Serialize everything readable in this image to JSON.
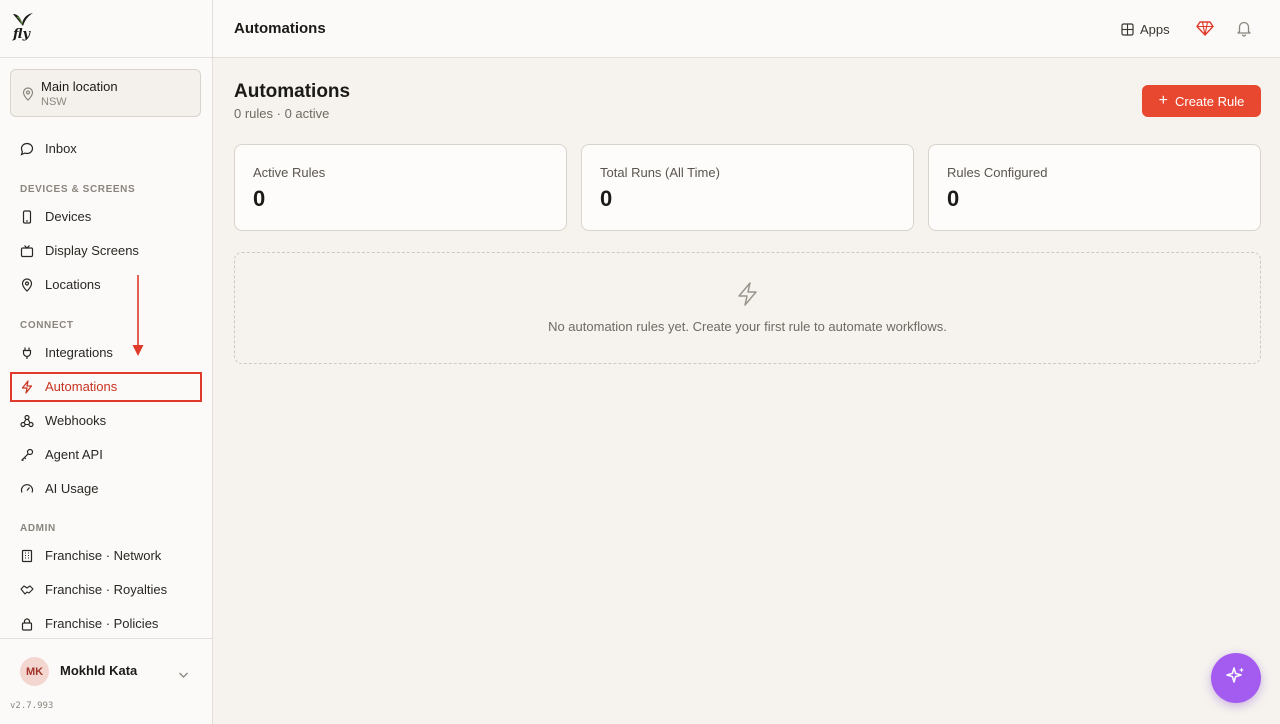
{
  "app": {
    "logo_text": "fly",
    "version": "v2.7.993"
  },
  "location": {
    "name": "Main location",
    "region": "NSW"
  },
  "sidebar": {
    "inbox": {
      "label": "Inbox",
      "icon": "chat-bubble-icon"
    },
    "sections": [
      {
        "title": "DEVICES & SCREENS",
        "items": [
          {
            "label": "Devices",
            "icon": "phone-icon"
          },
          {
            "label": "Display Screens",
            "icon": "tv-icon"
          },
          {
            "label": "Locations",
            "icon": "map-pin-icon"
          }
        ]
      },
      {
        "title": "CONNECT",
        "items": [
          {
            "label": "Integrations",
            "icon": "plug-icon"
          },
          {
            "label": "Automations",
            "icon": "bolt-icon",
            "active": true
          },
          {
            "label": "Webhooks",
            "icon": "webhook-icon"
          },
          {
            "label": "Agent API",
            "icon": "key-icon"
          },
          {
            "label": "AI Usage",
            "icon": "gauge-icon"
          }
        ]
      },
      {
        "title": "ADMIN",
        "items": [
          {
            "label": "Franchise · Network",
            "icon": "building-icon"
          },
          {
            "label": "Franchise · Royalties",
            "icon": "handshake-icon"
          },
          {
            "label": "Franchise · Policies",
            "icon": "lock-icon"
          }
        ]
      }
    ]
  },
  "user": {
    "initials": "MK",
    "name": "Mokhld Kata"
  },
  "topbar": {
    "title": "Automations",
    "apps_label": "Apps"
  },
  "page": {
    "title": "Automations",
    "subtitle": "0 rules · 0 active",
    "create_label": "Create Rule"
  },
  "stats": [
    {
      "label": "Active Rules",
      "value": "0"
    },
    {
      "label": "Total Runs (All Time)",
      "value": "0"
    },
    {
      "label": "Rules Configured",
      "value": "0"
    }
  ],
  "empty_state": {
    "text": "No automation rules yet. Create your first rule to automate workflows."
  },
  "colors": {
    "accent": "#e8482f",
    "active_outline": "#e03a2a",
    "fab": "#a45cf0"
  }
}
